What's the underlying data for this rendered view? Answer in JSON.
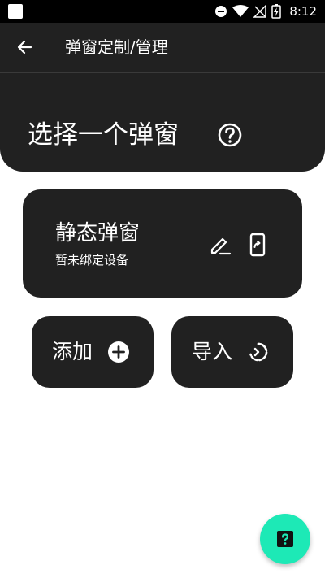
{
  "status_bar": {
    "time": "8:12",
    "icons": [
      "app-notification-icon",
      "do-not-disturb-icon",
      "wifi-icon",
      "no-signal-icon",
      "battery-charging-icon"
    ]
  },
  "app_bar": {
    "title": "弹窗定制/管理",
    "back_icon": "arrow-back-icon"
  },
  "header": {
    "section_title": "选择一个弹窗",
    "help_icon": "help-circle-icon"
  },
  "popup_card": {
    "title": "静态弹窗",
    "subtitle": "暂未绑定设备",
    "icons": [
      "edit-icon",
      "phone-link-icon"
    ]
  },
  "actions": {
    "add_label": "添加",
    "add_icon": "add-circle-icon",
    "import_label": "导入",
    "import_icon": "restore-icon"
  },
  "fab": {
    "icon": "help-center-icon"
  },
  "colors": {
    "dark_surface": "#212121",
    "status_bar": "#000000",
    "background": "#ffffff",
    "fab_accent": "#1de9b6",
    "text": "#ffffff"
  }
}
